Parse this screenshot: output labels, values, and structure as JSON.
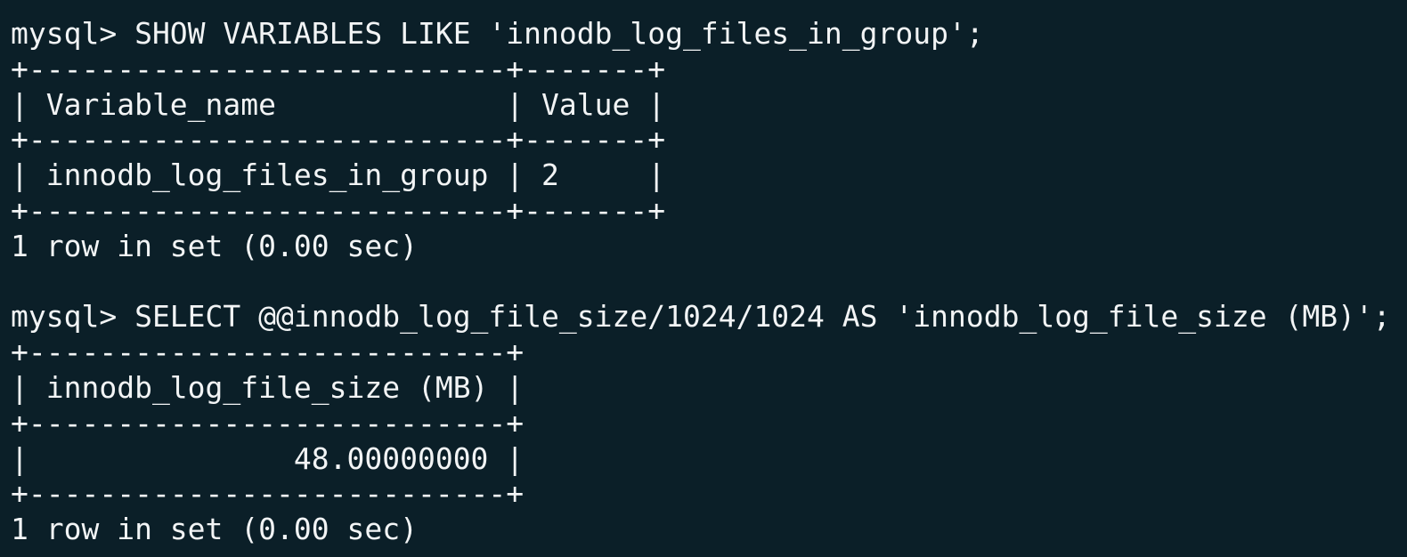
{
  "terminal": {
    "lines": [
      "mysql> SHOW VARIABLES LIKE 'innodb_log_files_in_group';",
      "+---------------------------+-------+",
      "| Variable_name             | Value |",
      "+---------------------------+-------+",
      "| innodb_log_files_in_group | 2     |",
      "+---------------------------+-------+",
      "1 row in set (0.00 sec)",
      "",
      "mysql> SELECT @@innodb_log_file_size/1024/1024 AS 'innodb_log_file_size (MB)';",
      "+---------------------------+",
      "| innodb_log_file_size (MB) |",
      "+---------------------------+",
      "|               48.00000000 |",
      "+---------------------------+",
      "1 row in set (0.00 sec)"
    ]
  }
}
